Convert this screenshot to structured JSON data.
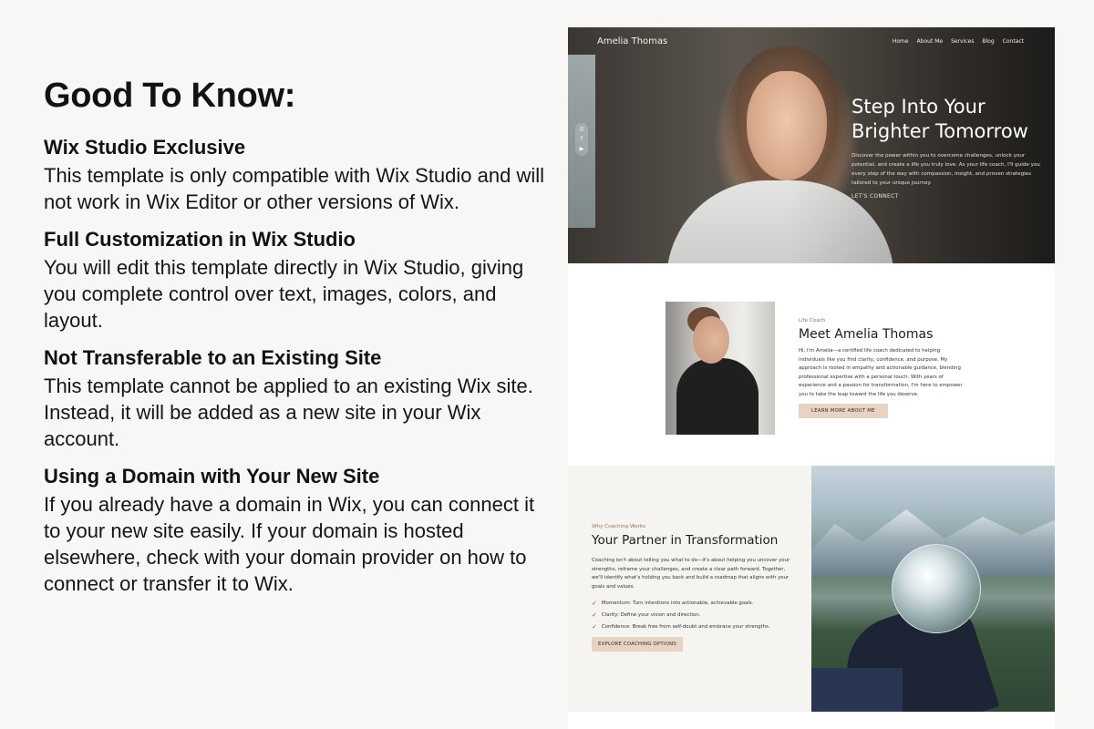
{
  "info": {
    "heading": "Good To Know:",
    "sections": [
      {
        "title": "Wix Studio Exclusive",
        "body": "This template is only compatible with Wix Studio and will not work in Wix Editor or other versions of Wix."
      },
      {
        "title": "Full Customization in Wix Studio",
        "body": "You will edit this template directly in Wix Studio, giving you complete control over text, images, colors, and layout."
      },
      {
        "title": "Not Transferable to an Existing Site",
        "body": "This template cannot be applied to an existing Wix site. Instead, it will be added as a new site in your Wix account."
      },
      {
        "title": "Using a Domain with Your New Site",
        "body": "If you already have a domain in Wix, you can connect it to your new site easily. If your domain is hosted elsewhere, check with your domain provider on how to connect or transfer it to Wix."
      }
    ]
  },
  "site": {
    "logo": "Amelia Thomas",
    "nav": [
      "Home",
      "About Me",
      "Services",
      "Blog",
      "Contact"
    ],
    "social_icons": [
      "instagram-icon",
      "facebook-icon",
      "youtube-icon"
    ],
    "social_glyphs": [
      "◎",
      "f",
      "▶"
    ],
    "hero": {
      "title": "Step Into Your Brighter Tomorrow",
      "text": "Discover the power within you to overcome challenges, unlock your potential, and create a life you truly love. As your life coach, I'll guide you every step of the way with compassion, insight, and proven strategies tailored to your unique journey.",
      "cta": "LET'S CONNECT"
    },
    "about": {
      "eyebrow": "Life Coach",
      "title": "Meet Amelia Thomas",
      "text": "Hi, I'm Amelia—a certified life coach dedicated to helping individuals like you find clarity, confidence, and purpose. My approach is rooted in empathy and actionable guidance, blending professional expertise with a personal touch. With years of experience and a passion for transformation, I'm here to empower you to take the leap toward the life you deserve.",
      "button": "LEARN MORE ABOUT ME"
    },
    "partner": {
      "eyebrow": "Why Coaching Works",
      "title": "Your Partner in Transformation",
      "text": "Coaching isn't about telling you what to do—it's about helping you uncover your strengths, reframe your challenges, and create a clear path forward. Together, we'll identify what's holding you back and build a roadmap that aligns with your goals and values.",
      "checks": [
        "Momentum: Turn intentions into actionable, achievable goals.",
        "Clarity: Define your vision and direction.",
        "Confidence: Break free from self-doubt and embrace your strengths."
      ],
      "check_glyph": "✓",
      "button": "EXPLORE COACHING OPTIONS"
    }
  }
}
